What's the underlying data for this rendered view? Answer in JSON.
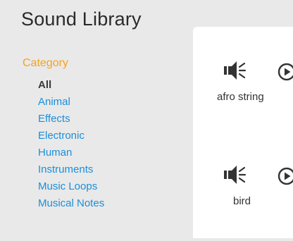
{
  "app": {
    "title": "Sound Library"
  },
  "sidebar": {
    "heading": "Category",
    "items": [
      {
        "label": "All",
        "selected": true
      },
      {
        "label": "Animal",
        "selected": false
      },
      {
        "label": "Effects",
        "selected": false
      },
      {
        "label": "Electronic",
        "selected": false
      },
      {
        "label": "Human",
        "selected": false
      },
      {
        "label": "Instruments",
        "selected": false
      },
      {
        "label": "Music Loops",
        "selected": false
      },
      {
        "label": "Musical Notes",
        "selected": false
      }
    ]
  },
  "sounds": [
    {
      "name": "afro string",
      "icon": "speaker-icon",
      "play_icon": "play-icon"
    },
    {
      "name": "bird",
      "icon": "speaker-icon",
      "play_icon": "play-icon"
    }
  ],
  "colors": {
    "background": "#e9e9e9",
    "panel": "#ffffff",
    "accent": "#f7a21a",
    "link": "#1a8fd9",
    "text": "#2a2a2a"
  }
}
